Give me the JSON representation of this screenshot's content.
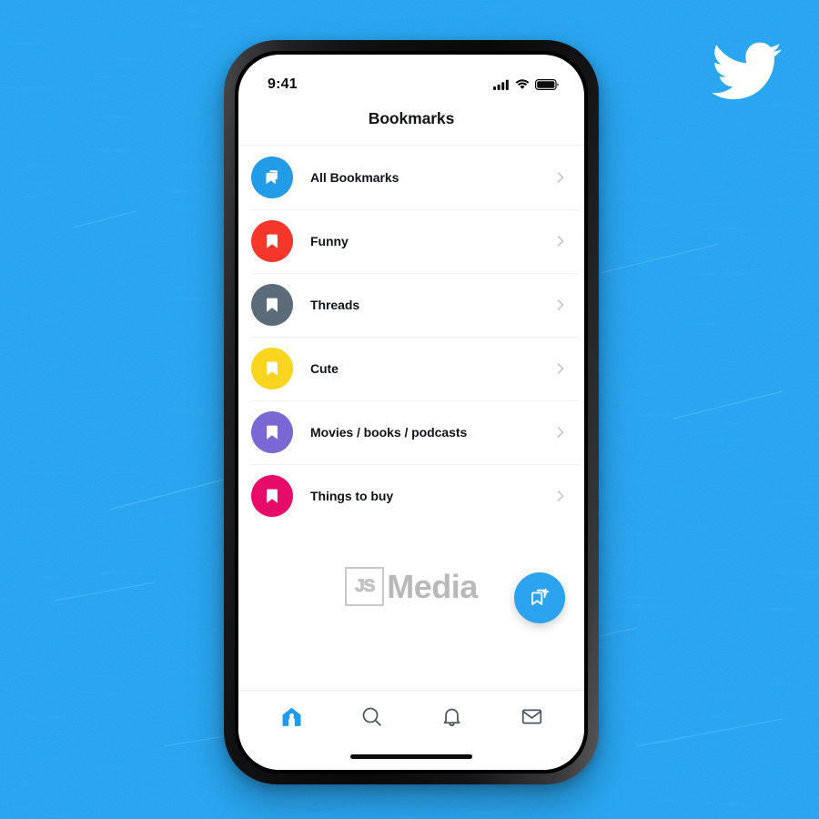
{
  "background": {
    "color": "#25A4F0",
    "texture": "white-scratch-grunge"
  },
  "brand_logo": {
    "name": "twitter-bird-logo",
    "color": "#FFFFFF"
  },
  "phone": {
    "frame_color": "#111113"
  },
  "statusbar": {
    "time": "9:41",
    "icons": [
      "cellular-signal-icon",
      "wifi-icon",
      "battery-icon"
    ]
  },
  "header": {
    "title": "Bookmarks"
  },
  "bookmarks": {
    "items": [
      {
        "label": "All Bookmarks",
        "color": "#239CE8",
        "icon": "bookmark-stack-icon"
      },
      {
        "label": "Funny",
        "color": "#F4372A",
        "icon": "bookmark-icon"
      },
      {
        "label": "Threads",
        "color": "#5C6B7A",
        "icon": "bookmark-icon"
      },
      {
        "label": "Cute",
        "color": "#FAD520",
        "icon": "bookmark-icon"
      },
      {
        "label": "Movies / books / podcasts",
        "color": "#7B68D4",
        "icon": "bookmark-icon"
      },
      {
        "label": "Things to buy",
        "color": "#E80C6A",
        "icon": "bookmark-icon"
      }
    ],
    "chevron_icon": "chevron-right-icon"
  },
  "watermark": {
    "badge": "JS",
    "text": "Media"
  },
  "fab": {
    "icon": "add-bookmark-icon",
    "color": "#2BA3EF",
    "label": "Add bookmark folder"
  },
  "tabbar": {
    "items": [
      {
        "icon": "home-icon",
        "active": true
      },
      {
        "icon": "search-icon",
        "active": false
      },
      {
        "icon": "notifications-bell-icon",
        "active": false
      },
      {
        "icon": "messages-envelope-icon",
        "active": false
      }
    ],
    "active_color": "#1D9BF0",
    "inactive_color": "#4A5662"
  }
}
